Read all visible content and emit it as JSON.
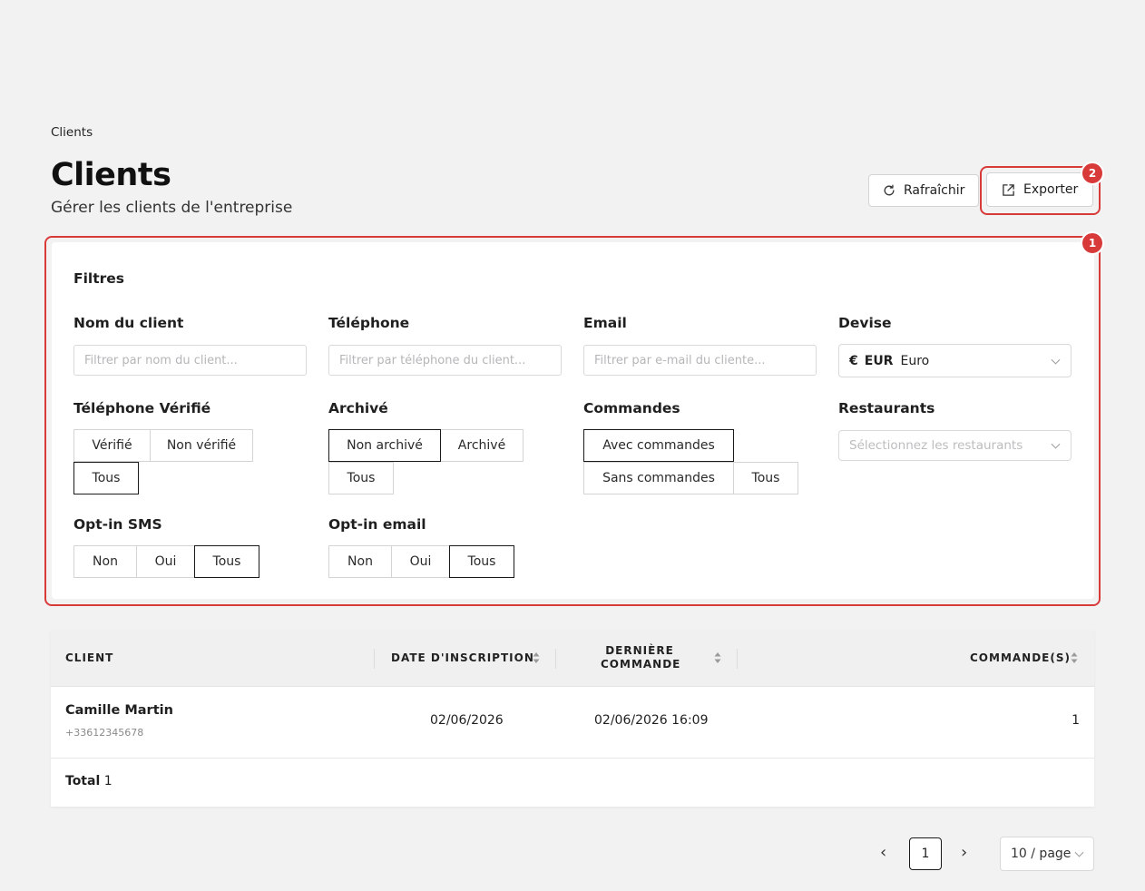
{
  "breadcrumb": "Clients",
  "header": {
    "title": "Clients",
    "subtitle": "Gérer les clients de l'entreprise",
    "refresh_label": "Rafraîchir",
    "export_label": "Exporter"
  },
  "markers": {
    "export": "2",
    "filters": "1"
  },
  "accent_color": "#d83a3a",
  "filters": {
    "title": "Filtres",
    "client_name": {
      "label": "Nom du client",
      "placeholder": "Filtrer par nom du client..."
    },
    "phone": {
      "label": "Téléphone",
      "placeholder": "Filtrer par téléphone du client..."
    },
    "email": {
      "label": "Email",
      "placeholder": "Filtrer par e-mail du cliente..."
    },
    "currency": {
      "label": "Devise",
      "symbol": "€",
      "code": "EUR",
      "name": "Euro"
    },
    "phone_verified": {
      "label": "Téléphone Vérifié",
      "options": [
        "Vérifié",
        "Non vérifié",
        "Tous"
      ],
      "selected": "Tous"
    },
    "archived": {
      "label": "Archivé",
      "options": [
        "Non archivé",
        "Archivé",
        "Tous"
      ],
      "selected": "Non archivé"
    },
    "orders": {
      "label": "Commandes",
      "options": [
        "Avec commandes",
        "Sans commandes",
        "Tous"
      ],
      "selected": "Avec commandes"
    },
    "restaurants": {
      "label": "Restaurants",
      "placeholder": "Sélectionnez les restaurants"
    },
    "sms_optin": {
      "label": "Opt-in SMS",
      "options": [
        "Non",
        "Oui",
        "Tous"
      ],
      "selected": "Tous"
    },
    "email_optin": {
      "label": "Opt-in email",
      "options": [
        "Non",
        "Oui",
        "Tous"
      ],
      "selected": "Tous"
    }
  },
  "table": {
    "columns": [
      "CLIENT",
      "DATE D'INSCRIPTION",
      "DERNIÈRE",
      "COMMANDE",
      "COMMANDE(S)"
    ],
    "rows": [
      {
        "name": "Camille Martin",
        "phone": "+33612345678",
        "signup_date": "02/06/2026",
        "last_order": "02/06/2026 16:09",
        "orders": "1"
      }
    ],
    "total_label": "Total",
    "total_value": "1"
  },
  "pagination": {
    "prev": "‹",
    "next": "›",
    "current_page": "1",
    "page_size": "10 / page"
  },
  "icons": [
    "refresh-icon",
    "export-icon",
    "chevron-down-icon",
    "sort-icon"
  ]
}
